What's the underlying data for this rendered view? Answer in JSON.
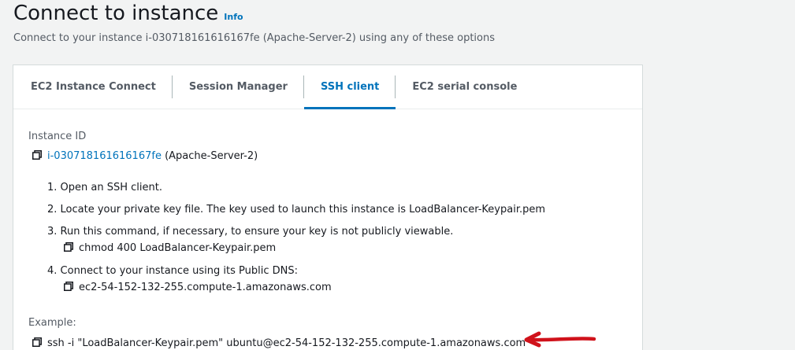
{
  "header": {
    "title": "Connect to instance",
    "info_label": "Info",
    "subtitle": "Connect to your instance i-030718161616167fe (Apache-Server-2) using any of these options"
  },
  "tabs": [
    {
      "label": "EC2 Instance Connect",
      "active": false
    },
    {
      "label": "Session Manager",
      "active": false
    },
    {
      "label": "SSH client",
      "active": true
    },
    {
      "label": "EC2 serial console",
      "active": false
    }
  ],
  "ssh": {
    "instance_id_label": "Instance ID",
    "instance_id": "i-030718161616167fe",
    "instance_name": "(Apache-Server-2)",
    "steps": [
      "1. Open an SSH client.",
      "2. Locate your private key file. The key used to launch this instance is LoadBalancer-Keypair.pem",
      "3. Run this command, if necessary, to ensure your key is not publicly viewable.",
      "4. Connect to your instance using its Public DNS:"
    ],
    "chmod_command": "chmod 400 LoadBalancer-Keypair.pem",
    "public_dns": "ec2-54-152-132-255.compute-1.amazonaws.com",
    "example_label": "Example:",
    "example_command": "ssh -i \"LoadBalancer-Keypair.pem\" ubuntu@ec2-54-152-132-255.compute-1.amazonaws.com"
  },
  "colors": {
    "accent": "#0073bb",
    "annotation_arrow": "#d0121b"
  }
}
